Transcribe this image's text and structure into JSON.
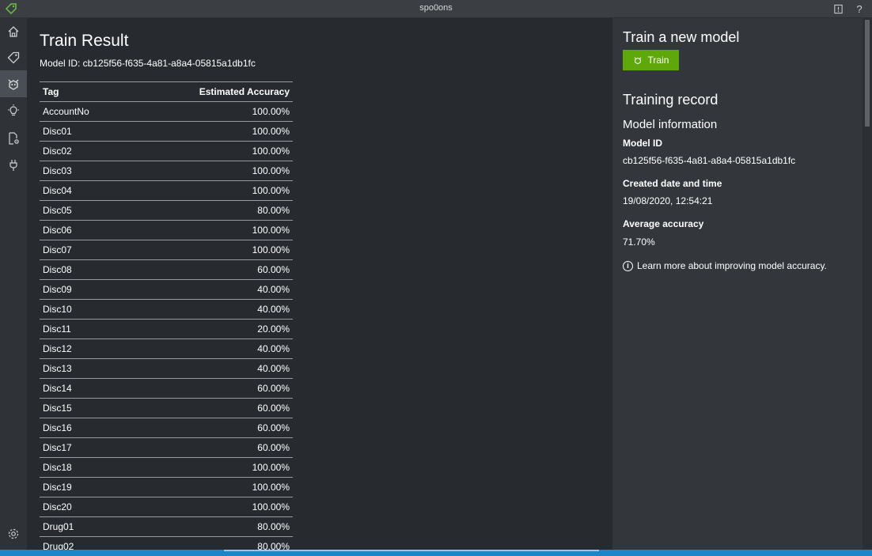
{
  "window": {
    "title": "spo0ons",
    "help_label": "?"
  },
  "sidebar": {
    "items": [
      {
        "name": "home-icon",
        "active": false
      },
      {
        "name": "tag-icon",
        "active": false
      },
      {
        "name": "train-icon",
        "active": true
      },
      {
        "name": "lightbulb-icon",
        "active": false
      },
      {
        "name": "document-settings-icon",
        "active": false
      },
      {
        "name": "plug-icon",
        "active": false
      }
    ],
    "bottom": {
      "name": "settings-icon"
    }
  },
  "main": {
    "title": "Train Result",
    "model_id_line": "Model ID: cb125f56-f635-4a81-a8a4-05815a1db1fc",
    "table": {
      "columns": [
        "Tag",
        "Estimated Accuracy"
      ],
      "rows": [
        [
          "AccountNo",
          "100.00%"
        ],
        [
          "Disc01",
          "100.00%"
        ],
        [
          "Disc02",
          "100.00%"
        ],
        [
          "Disc03",
          "100.00%"
        ],
        [
          "Disc04",
          "100.00%"
        ],
        [
          "Disc05",
          "80.00%"
        ],
        [
          "Disc06",
          "100.00%"
        ],
        [
          "Disc07",
          "100.00%"
        ],
        [
          "Disc08",
          "60.00%"
        ],
        [
          "Disc09",
          "40.00%"
        ],
        [
          "Disc10",
          "40.00%"
        ],
        [
          "Disc11",
          "20.00%"
        ],
        [
          "Disc12",
          "40.00%"
        ],
        [
          "Disc13",
          "40.00%"
        ],
        [
          "Disc14",
          "60.00%"
        ],
        [
          "Disc15",
          "60.00%"
        ],
        [
          "Disc16",
          "60.00%"
        ],
        [
          "Disc17",
          "60.00%"
        ],
        [
          "Disc18",
          "100.00%"
        ],
        [
          "Disc19",
          "100.00%"
        ],
        [
          "Disc20",
          "100.00%"
        ],
        [
          "Drug01",
          "80.00%"
        ],
        [
          "Drug02",
          "80.00%"
        ]
      ]
    }
  },
  "right_panel": {
    "train_heading": "Train a new model",
    "train_button": "Train",
    "record_heading": "Training record",
    "model_info_heading": "Model information",
    "model_id_label": "Model ID",
    "model_id_value": "cb125f56-f635-4a81-a8a4-05815a1db1fc",
    "created_label": "Created date and time",
    "created_value": "19/08/2020, 12:54:21",
    "avg_label": "Average accuracy",
    "avg_value": "71.70%",
    "learn_more": "Learn more about improving model accuracy."
  },
  "colors": {
    "accent_green": "#5ea80c",
    "background": "#272b30",
    "panel": "#33373c",
    "sidebar": "#2f3338",
    "status_strip": "#1b86c9"
  }
}
